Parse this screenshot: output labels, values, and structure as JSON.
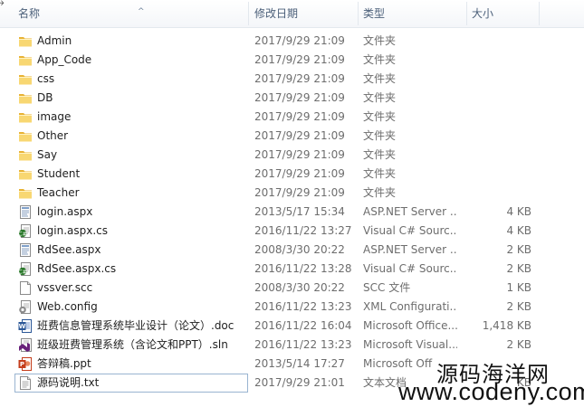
{
  "columns": {
    "name": "名称",
    "date": "修改日期",
    "type": "类型",
    "size": "大小"
  },
  "files": [
    {
      "name": "Admin",
      "date": "2017/9/29 21:09",
      "type": "文件夹",
      "size": "",
      "icon": "folder-icon"
    },
    {
      "name": "App_Code",
      "date": "2017/9/29 21:09",
      "type": "文件夹",
      "size": "",
      "icon": "folder-icon"
    },
    {
      "name": "css",
      "date": "2017/9/29 21:09",
      "type": "文件夹",
      "size": "",
      "icon": "folder-icon"
    },
    {
      "name": "DB",
      "date": "2017/9/29 21:09",
      "type": "文件夹",
      "size": "",
      "icon": "folder-icon"
    },
    {
      "name": "image",
      "date": "2017/9/29 21:09",
      "type": "文件夹",
      "size": "",
      "icon": "folder-icon"
    },
    {
      "name": "Other",
      "date": "2017/9/29 21:09",
      "type": "文件夹",
      "size": "",
      "icon": "folder-icon"
    },
    {
      "name": "Say",
      "date": "2017/9/29 21:09",
      "type": "文件夹",
      "size": "",
      "icon": "folder-icon"
    },
    {
      "name": "Student",
      "date": "2017/9/29 21:09",
      "type": "文件夹",
      "size": "",
      "icon": "folder-icon"
    },
    {
      "name": "Teacher",
      "date": "2017/9/29 21:09",
      "type": "文件夹",
      "size": "",
      "icon": "folder-icon"
    },
    {
      "name": "login.aspx",
      "date": "2013/5/17 15:34",
      "type": "ASP.NET Server ...",
      "size": "4 KB",
      "icon": "aspx-file-icon"
    },
    {
      "name": "login.aspx.cs",
      "date": "2016/11/22 13:27",
      "type": "Visual C# Sourc...",
      "size": "4 KB",
      "icon": "csharp-file-icon"
    },
    {
      "name": "RdSee.aspx",
      "date": "2008/3/30 20:22",
      "type": "ASP.NET Server ...",
      "size": "2 KB",
      "icon": "aspx-file-icon"
    },
    {
      "name": "RdSee.aspx.cs",
      "date": "2016/11/22 13:28",
      "type": "Visual C# Sourc...",
      "size": "2 KB",
      "icon": "csharp-file-icon"
    },
    {
      "name": "vssver.scc",
      "date": "2008/3/30 20:22",
      "type": "SCC 文件",
      "size": "1 KB",
      "icon": "blank-file-icon"
    },
    {
      "name": "Web.config",
      "date": "2016/11/22 13:23",
      "type": "XML Configurati...",
      "size": "2 KB",
      "icon": "config-file-icon"
    },
    {
      "name": "班费信息管理系统毕业设计（论文）.doc",
      "date": "2016/11/22 16:04",
      "type": "Microsoft Office...",
      "size": "1,418 KB",
      "icon": "word-doc-icon"
    },
    {
      "name": "班级班费管理系统（含论文和PPT）.sln",
      "date": "2016/11/22 13:23",
      "type": "Microsoft Visual...",
      "size": "2 KB",
      "icon": "visual-studio-sln-icon"
    },
    {
      "name": "答辩稿.ppt",
      "date": "2013/5/14 17:27",
      "type": "Microsoft Off",
      "size": "",
      "icon": "powerpoint-icon"
    },
    {
      "name": "源码说明.txt",
      "date": "2017/9/29 21:01",
      "type": "文本文档",
      "size": "KB",
      "icon": "text-file-icon"
    }
  ],
  "watermark": {
    "chinese": "源码海洋网",
    "url": "www.codeny.com"
  }
}
